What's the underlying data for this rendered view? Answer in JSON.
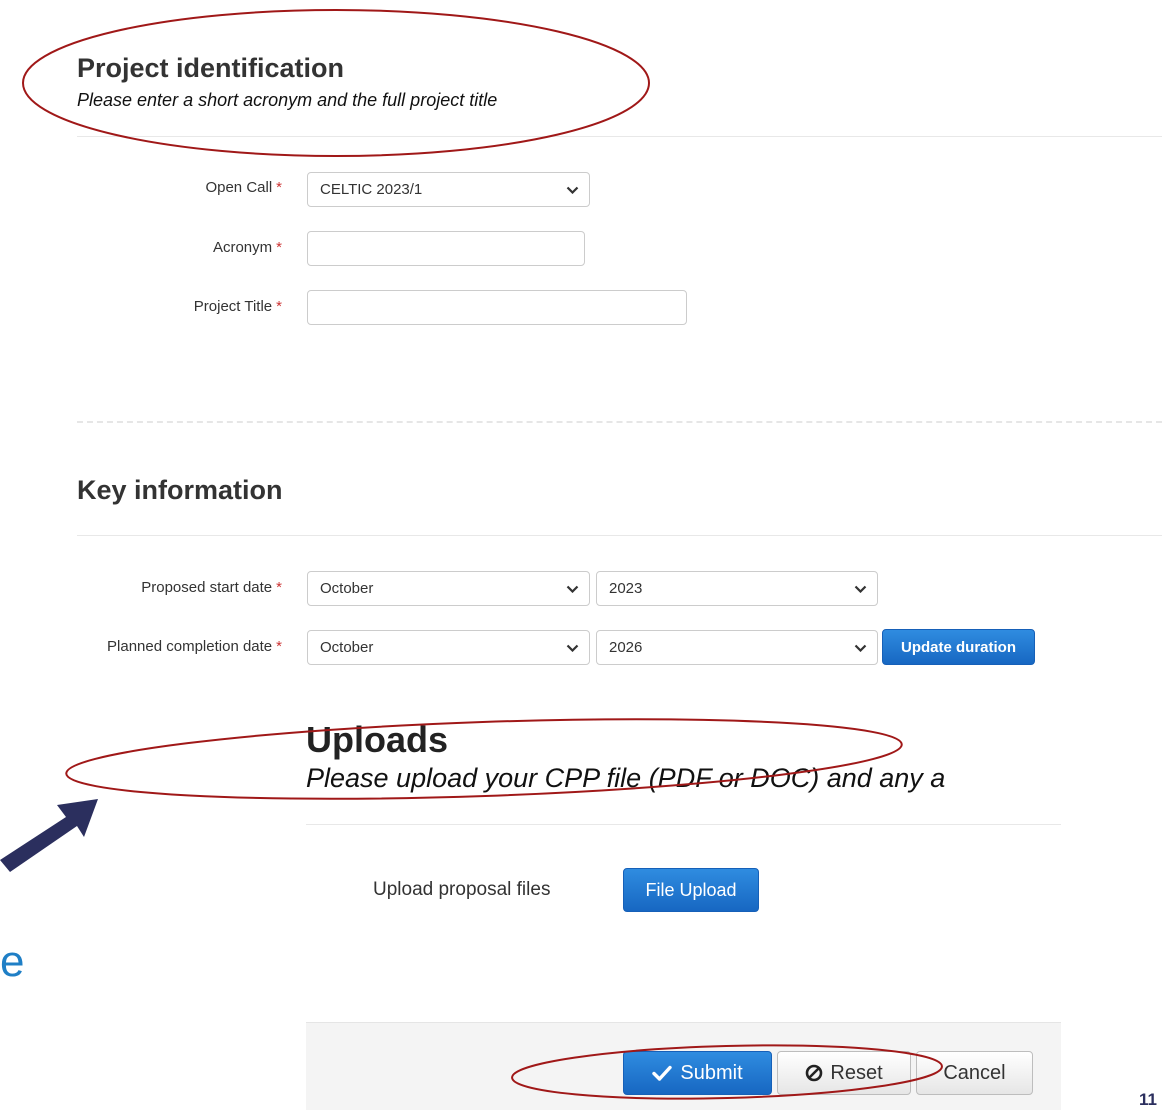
{
  "project": {
    "title": "Project identification",
    "subtitle": "Please enter a short acronym and the full project title",
    "open_call": {
      "label": "Open Call",
      "value": "CELTIC 2023/1"
    },
    "acronym": {
      "label": "Acronym",
      "value": ""
    },
    "project_title": {
      "label": "Project Title",
      "value": ""
    }
  },
  "required_mark": "*",
  "key_info": {
    "title": "Key information",
    "start": {
      "label": "Proposed start date",
      "month": "October",
      "year": "2023"
    },
    "completion": {
      "label": "Planned completion date",
      "month": "October",
      "year": "2026"
    },
    "update_button": "Update duration"
  },
  "uploads": {
    "title": "Uploads",
    "subtitle": "Please upload your CPP file (PDF or DOC) and any a",
    "upload_label": "Upload proposal files",
    "file_upload_button": "File Upload"
  },
  "actions": {
    "submit": "Submit",
    "reset": "Reset",
    "cancel": "Cancel"
  },
  "background_fragment": "e",
  "slide_number": "11",
  "colors": {
    "accent_blue": "#1767c2",
    "annotation_red": "#a01818",
    "arrow_navy": "#2b2f5e",
    "required_red": "#cc3333"
  },
  "icons": {
    "dropdown": "chevron-down-icon",
    "submit": "checkmark-icon",
    "reset": "ban-icon"
  }
}
